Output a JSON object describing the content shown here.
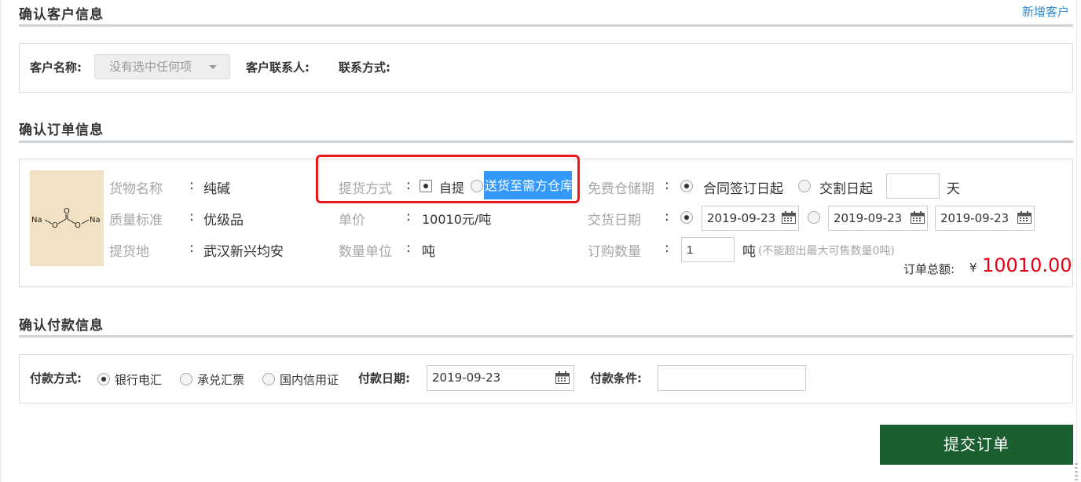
{
  "header": {
    "add_customer_link": "新增客户"
  },
  "customer": {
    "section_title": "确认客户信息",
    "name_label": "客户名称",
    "name_select_value": "没有选中任何项",
    "contact_label": "客户联系人",
    "phone_label": "联系方式",
    "colon": ":"
  },
  "order": {
    "section_title": "确认订单信息",
    "image_labels": {
      "na_left": "Na",
      "o": "O",
      "na_right": "Na"
    },
    "goods_name_label": "货物名称",
    "goods_name": "纯碱",
    "quality_label": "质量标准",
    "quality": "优级品",
    "pickup_place_label": "提货地",
    "pickup_place": "武汉新兴均安",
    "pickup_method_label": "提货方式",
    "pickup_option_self": "自提",
    "pickup_option_delivery": "送货至需方仓库",
    "unit_price_label": "单价",
    "unit_price": "10010元/吨",
    "qty_unit_label": "数量单位",
    "qty_unit": "吨",
    "free_storage_label": "免费仓储期",
    "storage_option_contract": "合同签订日起",
    "storage_option_delivery": "交割日起",
    "storage_days": "",
    "storage_days_unit": "天",
    "delivery_date_label": "交货日期",
    "delivery_date_1": "2019-09-23",
    "delivery_date_2": "2019-09-23",
    "delivery_date_3": "2019-09-23",
    "purchase_qty_label": "订购数量",
    "purchase_qty": "1",
    "purchase_qty_unit": "吨",
    "purchase_qty_hint": "(不能超出最大可售数量0吨)",
    "total_label": "订单总额:",
    "currency": "¥",
    "total_value": "10010.00",
    "colon": ":"
  },
  "payment": {
    "section_title": "确认付款信息",
    "method_label": "付款方式",
    "method_bank": "银行电汇",
    "method_draft": "承兑汇票",
    "method_lc": "国内信用证",
    "date_label": "付款日期",
    "date_value": "2019-09-23",
    "terms_label": "付款条件",
    "terms_value": "",
    "colon": ":"
  },
  "actions": {
    "submit_label": "提交订单"
  },
  "colors": {
    "accent_green": "#1b5e30",
    "total_red": "#e60012",
    "highlight_blue": "#3399ff",
    "annotation_red": "#e8171c"
  },
  "icons": [
    "calendar-icon",
    "chevron-down-icon",
    "radio-icon"
  ]
}
